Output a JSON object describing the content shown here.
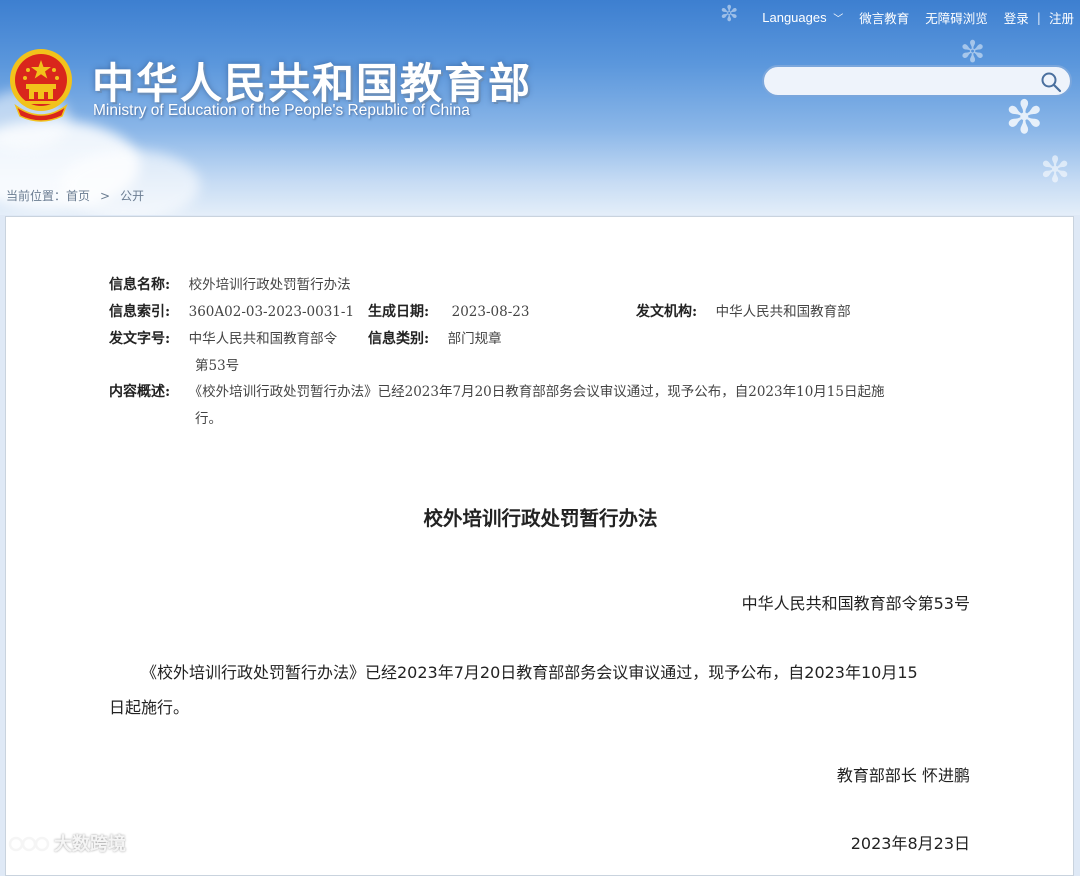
{
  "topnav": {
    "languages": "Languages",
    "weibo": "微言教育",
    "accessibility": "无障碍浏览",
    "login": "登录",
    "separator": "|",
    "register": "注册"
  },
  "header": {
    "title": "中华人民共和国教育部",
    "subtitle": "Ministry of Education of the People's Republic of China"
  },
  "search": {
    "placeholder": ""
  },
  "breadcrumb": {
    "prefix": "当前位置：",
    "home": "首页",
    "separator": ">",
    "current": "公开"
  },
  "meta": {
    "name_label": "信息名称:",
    "name_value": "校外培训行政处罚暂行办法",
    "index_label": "信息索引:",
    "index_value": "360A02-03-2023-0031-1",
    "date_label": "生成日期:",
    "date_value": "2023-08-23",
    "org_label": "发文机构:",
    "org_value": "中华人民共和国教育部",
    "docno_label": "发文字号:",
    "docno_value_1": "中华人民共和国教育部令",
    "docno_value_2": "第53号",
    "category_label": "信息类别:",
    "category_value": "部门规章",
    "summary_label": "内容概述:",
    "summary_line_1": "《校外培训行政处罚暂行办法》已经2023年7月20日教育部部务会议审议通过，现予公布，自2023年10月15日起施",
    "summary_line_2": "行。"
  },
  "document": {
    "title": "校外培训行政处罚暂行办法",
    "order_no": "中华人民共和国教育部令第53号",
    "body_line_1": "《校外培训行政处罚暂行办法》已经2023年7月20日教育部部务会议审议通过，现予公布，自2023年10月15",
    "body_line_2": "日起施行。",
    "signature": "教育部部长 怀进鹏",
    "date": "2023年8月23日"
  },
  "watermark": {
    "text": "大数跨境"
  },
  "colors": {
    "header_top": "#3d7fd0",
    "header_bottom": "#e4eef9",
    "panel_bg": "#ffffff",
    "emblem_red": "#d9261c",
    "emblem_gold": "#f2c21b"
  }
}
